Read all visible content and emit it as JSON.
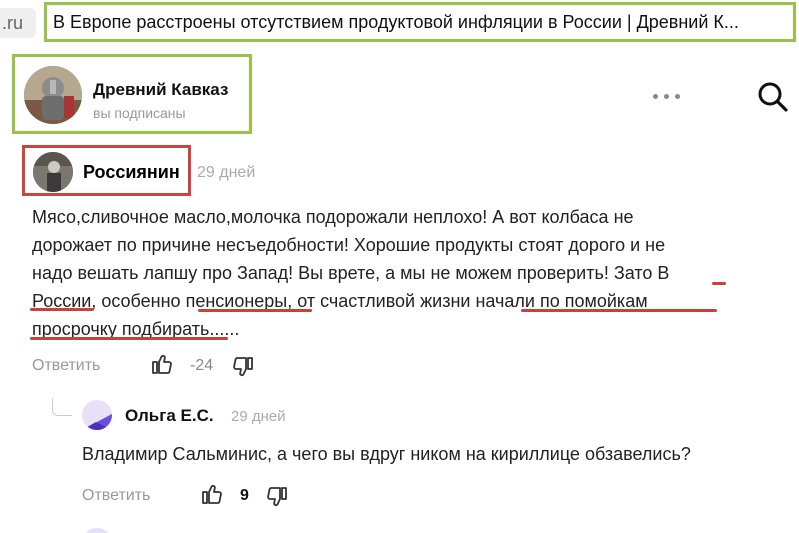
{
  "browser": {
    "url_fragment": ".ru",
    "page_title": "В Европе расстроены отсутствием продуктовой инфляции в России | Древний К..."
  },
  "channel": {
    "name": "Древний Кавказ",
    "subscription_status": "вы подписаны"
  },
  "toolbar": {
    "more_icon": "more-dots-icon",
    "search_icon": "search-icon"
  },
  "comment": {
    "author": "Россиянин",
    "time": "29 дней",
    "lines": [
      "Мясо,сливочное масло,молочка подорожали неплохо! А вот колбаса не",
      "дорожает по причине несъедобности! Хорошие продукты стоят дорого и не",
      "надо вешать лапшу про Запад! Вы врете, а мы не можем проверить! Зато В",
      "России, особенно пенсионеры, от счастливой жизни начали по помойкам",
      "просрочку подбирать......"
    ],
    "reply_label": "Ответить",
    "like_count": "-24"
  },
  "reply": {
    "author": "Ольга Е.С.",
    "time": "29 дней",
    "text": "Владимир Сальминис, а чего вы вдруг ником на кириллице обзавелись?",
    "reply_label": "Ответить",
    "like_count": "9"
  },
  "colors": {
    "highlight_green": "#9ac24a",
    "highlight_red": "#d0433c",
    "muted_text": "#999999"
  }
}
